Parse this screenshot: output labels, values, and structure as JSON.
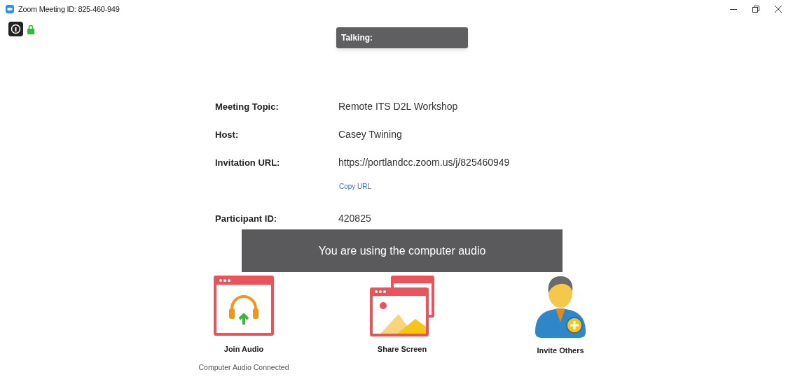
{
  "window": {
    "title": "Zoom Meeting ID: 825-460-949"
  },
  "talking": {
    "label": "Talking:"
  },
  "meeting_info": [
    {
      "label": "Meeting Topic:",
      "value": "Remote ITS D2L Workshop"
    },
    {
      "label": "Host:",
      "value": "Casey Twining"
    },
    {
      "label": "Invitation URL:",
      "value": "https://portlandcc.zoom.us/j/825460949",
      "link": "Copy URL"
    },
    {
      "label": "Participant ID:",
      "value": "420825"
    }
  ],
  "toast": {
    "message": "You are using the computer audio"
  },
  "actions": [
    {
      "kind": "audio",
      "label": "Join Audio",
      "status": "Computer Audio Connected"
    },
    {
      "kind": "share",
      "label": "Share Screen"
    },
    {
      "kind": "invite",
      "label": "Invite Others"
    }
  ]
}
